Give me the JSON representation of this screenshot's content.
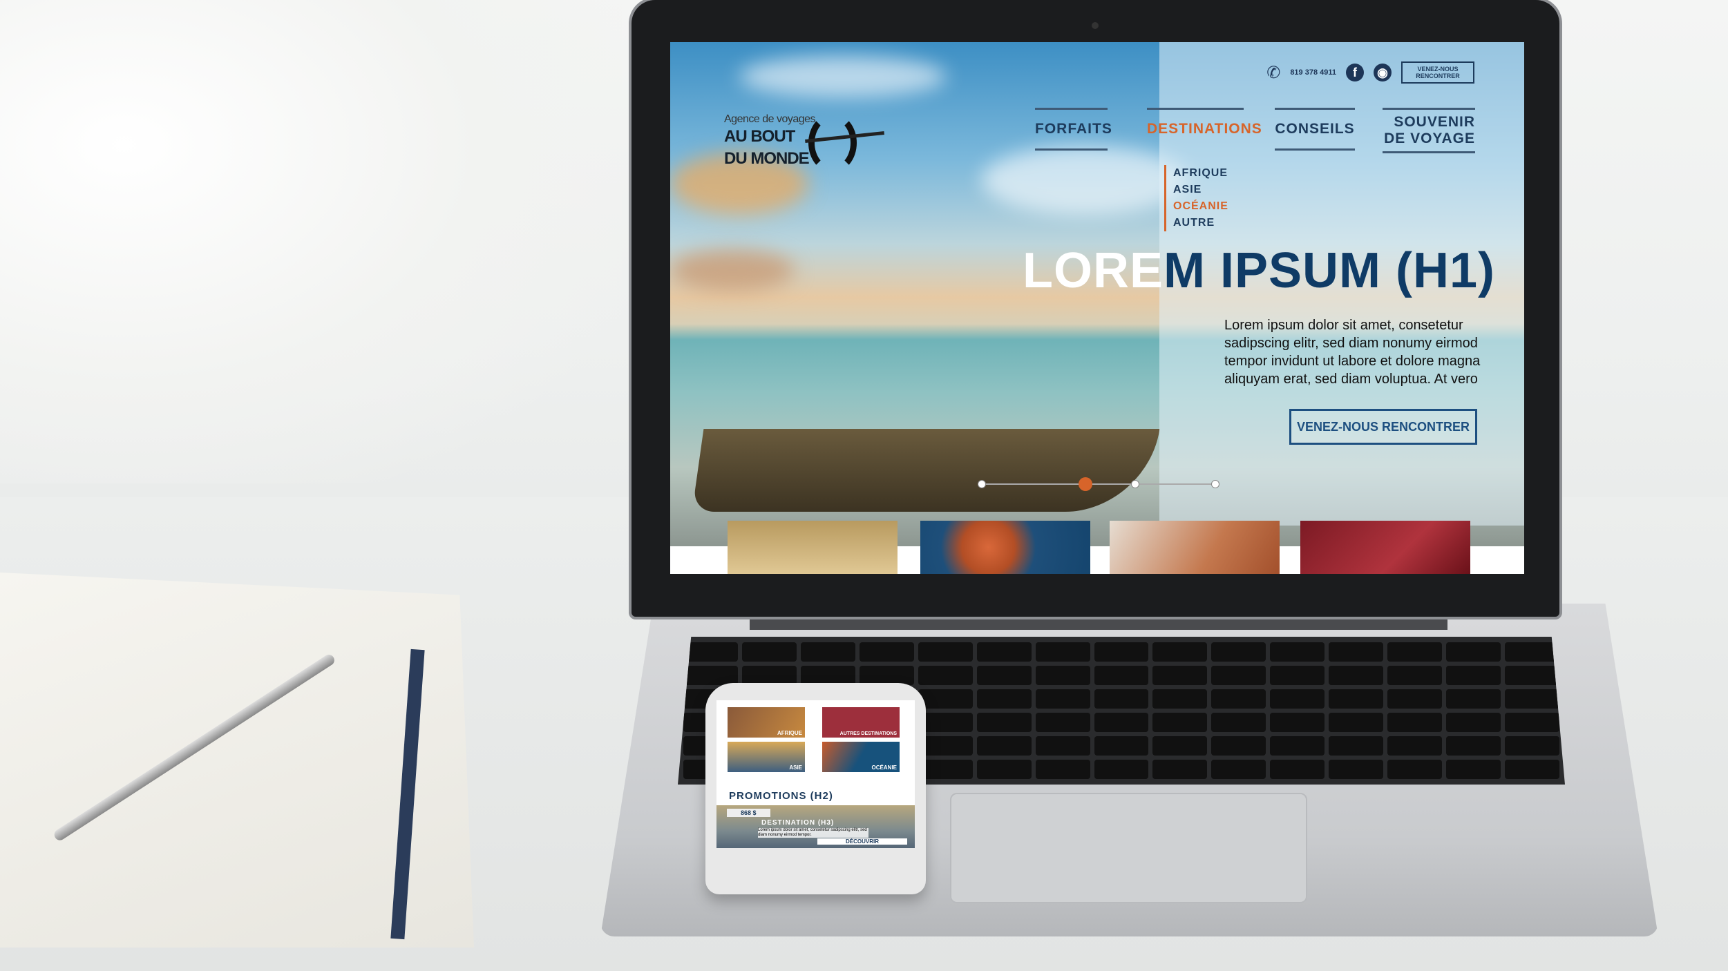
{
  "site": {
    "logo": {
      "tagline": "Agence de voyages",
      "name_line1": "AU BOUT",
      "name_line2": "DU MONDE"
    },
    "topbar": {
      "phone": "819 378 4911",
      "phone_icon": "phone-icon",
      "facebook_icon": "facebook-icon",
      "tripadvisor_icon": "tripadvisor-icon",
      "meet_button": "VENEZ-NOUS RENCONTRER"
    },
    "nav": [
      {
        "label": "FORFAITS"
      },
      {
        "label": "DESTINATIONS",
        "active": true
      },
      {
        "label": "CONSEILS"
      },
      {
        "label": "SOUVENIR DE VOYAGE"
      }
    ],
    "dropdown": [
      "AFRIQUE",
      "ASIE",
      "OCÉANIE",
      "AUTRE"
    ],
    "hero": {
      "h1_light": "LORE",
      "h1_dark": "M IPSUM (H1)",
      "paragraph": "Lorem ipsum dolor sit amet, consetetur sadipscing elitr, sed diam nonumy eirmod tempor invidunt ut labore et dolore magna aliquyam erat, sed diam voluptua. At vero",
      "cta": "VENEZ-NOUS RENCONTRER",
      "slider_active_index": 1,
      "slider_count": 4
    },
    "colors": {
      "accent": "#d7642a",
      "navy": "#1d3b5c"
    }
  },
  "mobile": {
    "tiles": [
      "AFRIQUE",
      "AUTRES DESTINATIONS",
      "ASIE",
      "OCÉANIE"
    ],
    "promotions_title": "PROMOTIONS (H2)",
    "price": "868 $",
    "destination_title": "DESTINATION (H3)",
    "destination_text": "Lorem ipsum dolor sit amet, consetetur sadipscing elitr, sed diam nonumy eirmod tempor.",
    "discover_button": "DÉCOUVRIR"
  }
}
